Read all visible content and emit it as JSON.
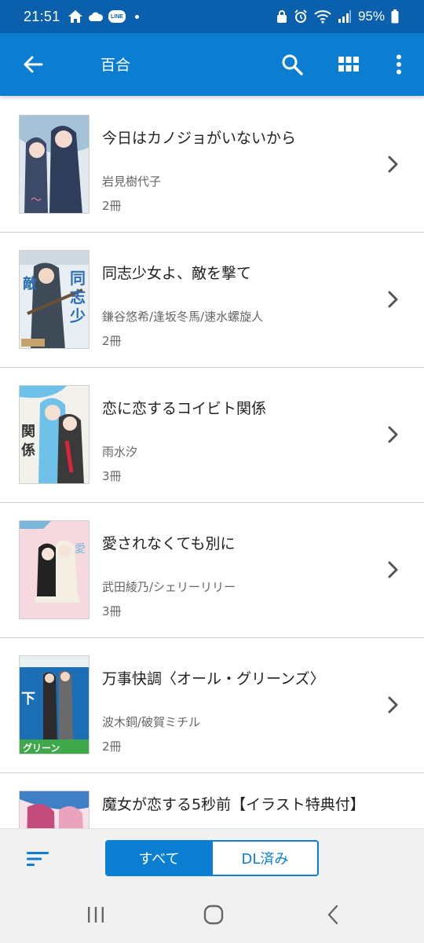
{
  "status": {
    "time": "21:51",
    "line_label": "LINE",
    "battery": "95%"
  },
  "appbar": {
    "title": "百合"
  },
  "books": [
    {
      "title": "今日はカノジョがいないから",
      "author": "岩見樹代子",
      "count": "2冊",
      "cover": {
        "bg": "#dfe9ee",
        "accent": "#2f3c5a",
        "accent2": "#7fa8c8",
        "text": "#f07aa6"
      }
    },
    {
      "title": "同志少女よ、敵を撃て",
      "author": "鎌谷悠希/逢坂冬馬/速水螺旋人",
      "count": "2冊",
      "cover": {
        "bg": "#e8eef3",
        "accent": "#3e4a56",
        "accent2": "#c7a36c",
        "text": "#2d6fb7"
      }
    },
    {
      "title": "恋に恋するコイビト関係",
      "author": "雨水汐",
      "count": "3冊",
      "cover": {
        "bg": "#f3f1ec",
        "accent": "#6ec1e8",
        "accent2": "#d7263d",
        "text": "#333333"
      }
    },
    {
      "title": "愛されなくても別に",
      "author": "武田綾乃/シェリーリリー",
      "count": "3冊",
      "cover": {
        "bg": "#f6d9df",
        "accent": "#222222",
        "accent2": "#f4efe3",
        "text": "#7ab8d9"
      }
    },
    {
      "title": "万事快調〈オール・グリーンズ〉",
      "author": "波木銅/破賀ミチル",
      "count": "2冊",
      "cover": {
        "bg": "#e9f0f2",
        "accent": "#1c6fb5",
        "accent2": "#3ea84a",
        "text": "#ffffff"
      }
    },
    {
      "title": "魔女が恋する5秒前【イラスト特典付】",
      "author": "",
      "count": "",
      "cover": {
        "bg": "#f7e2ea",
        "accent": "#c44c7c",
        "accent2": "#3f7fc4",
        "text": "#ffffff"
      }
    }
  ],
  "filter": {
    "all_label": "すべて",
    "downloaded_label": "DL済み",
    "active": "all"
  },
  "icons": {
    "back": "arrow-left-icon",
    "search": "search-icon",
    "grid": "grid-view-icon",
    "more": "more-vert-icon",
    "chevron": "chevron-right-icon",
    "sort": "sort-icon",
    "nav_recent": "recent-apps-icon",
    "nav_home": "home-icon",
    "nav_back": "nav-back-icon"
  },
  "colors": {
    "status_bg": "#0a60ac",
    "appbar_bg": "#0b7ed1",
    "accent": "#0b7ed1"
  }
}
